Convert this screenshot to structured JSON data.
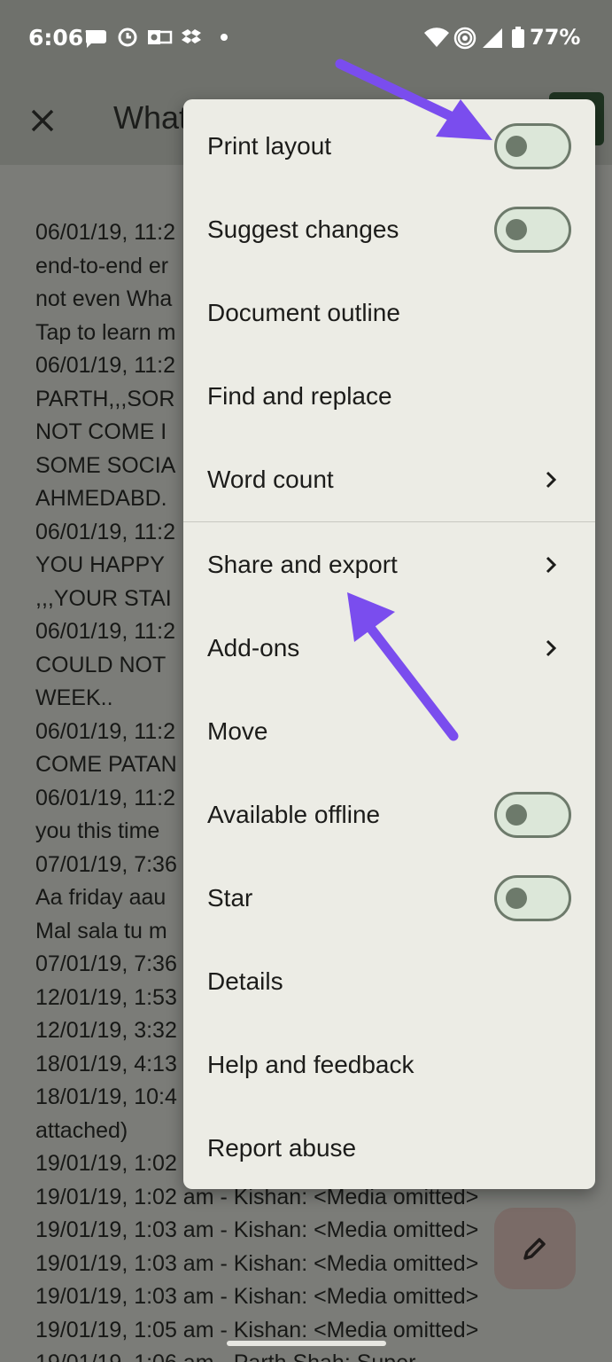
{
  "status_bar": {
    "time": "6:06",
    "battery": "77%",
    "icons": [
      "chat-icon",
      "sync-icon",
      "outlook-icon",
      "dropbox-icon",
      "dot-icon",
      "wifi-icon",
      "hotspot-icon",
      "signal-icon",
      "battery-icon"
    ]
  },
  "app_bar": {
    "title": "What"
  },
  "document": {
    "lines": [
      "06/01/19, 11:2",
      "end-to-end er",
      "not even Wha",
      "Tap to learn m",
      "06/01/19, 11:2",
      "PARTH,,,SOR",
      "NOT COME I",
      "SOME SOCIA",
      "AHMEDABD.",
      "06/01/19, 11:2",
      "YOU HAPPY",
      ",,,YOUR STAI",
      "06/01/19, 11:2",
      "COULD NOT",
      "WEEK..",
      "06/01/19, 11:2",
      "COME PATAN",
      "06/01/19, 11:2",
      "you this time",
      "07/01/19, 7:36",
      "Aa friday aau",
      "Mal sala tu m",
      "07/01/19, 7:36",
      "12/01/19, 1:53",
      "12/01/19, 3:32",
      "18/01/19, 4:13",
      "18/01/19, 10:4",
      "attached)",
      "19/01/19, 1:02",
      "19/01/19, 1:02 am - Kishan: <Media omitted>",
      "19/01/19, 1:03 am - Kishan: <Media omitted>",
      "19/01/19, 1:03 am - Kishan: <Media omitted>",
      "19/01/19, 1:03 am - Kishan: <Media omitted>",
      "19/01/19, 1:05 am - Kishan: <Media omitted>",
      "19/01/19, 1:06 am - Parth Shah: Super"
    ]
  },
  "menu": {
    "items": [
      {
        "label": "Print layout",
        "control": "toggle",
        "checked": false
      },
      {
        "label": "Suggest changes",
        "control": "toggle",
        "checked": false
      },
      {
        "label": "Document outline",
        "control": "none"
      },
      {
        "label": "Find and replace",
        "control": "none"
      },
      {
        "label": "Word count",
        "control": "chevron"
      },
      {
        "label": "Share and export",
        "control": "chevron"
      },
      {
        "label": "Add-ons",
        "control": "chevron"
      },
      {
        "label": "Move",
        "control": "none"
      },
      {
        "label": "Available offline",
        "control": "toggle",
        "checked": false
      },
      {
        "label": "Star",
        "control": "toggle",
        "checked": false
      },
      {
        "label": "Details",
        "control": "none"
      },
      {
        "label": "Help and feedback",
        "control": "none"
      },
      {
        "label": "Report abuse",
        "control": "none"
      }
    ]
  },
  "annotations": {
    "arrow_color": "#7a4dee"
  },
  "colors": {
    "scrim": "#6f716c",
    "menu_background": "#ecece5",
    "toggle_track": "#dce7d9",
    "toggle_outline": "#6d7a6b",
    "fab": "#7a6b67"
  }
}
